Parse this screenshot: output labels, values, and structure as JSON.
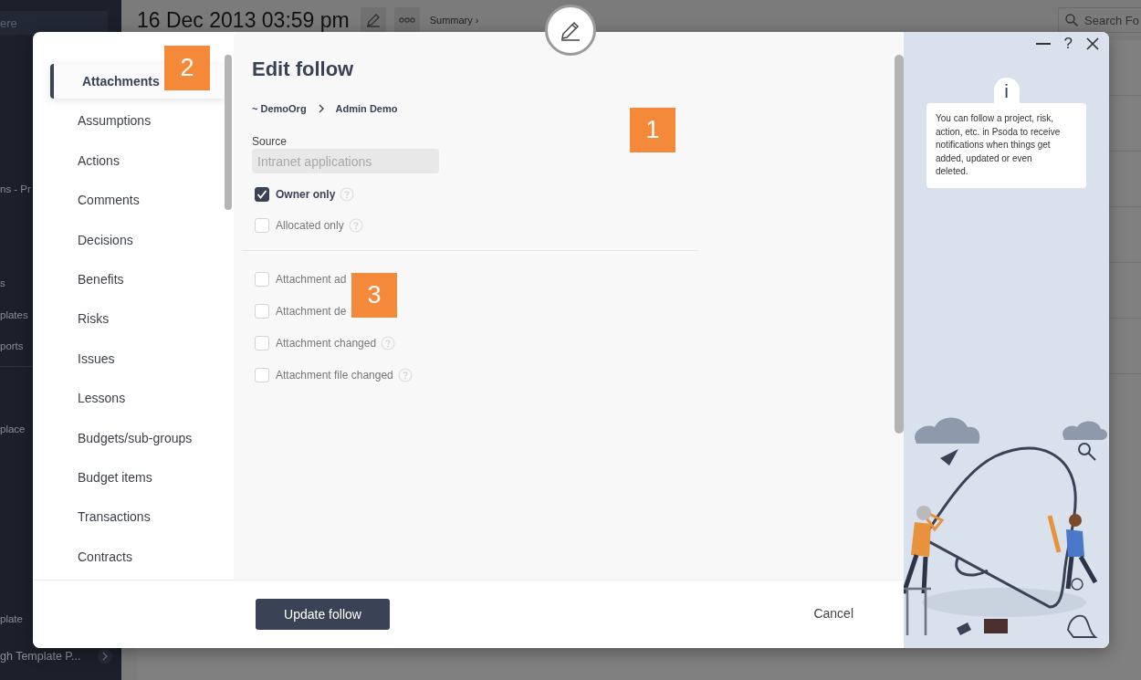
{
  "app_sidebar": {
    "search_placeholder": "ere",
    "items": [
      {
        "label": "ns - Pr"
      },
      {
        "label": "s"
      },
      {
        "label": "plates"
      },
      {
        "label": "ports"
      },
      {
        "label": "place"
      },
      {
        "label": "plate"
      },
      {
        "label": "gh Template P...",
        "has_chevron": true
      }
    ]
  },
  "header": {
    "title": "16 Dec 2013 03:59 pm",
    "summary_link": "Summary ›",
    "search_placeholder": "Search Fo"
  },
  "modal": {
    "nav": [
      {
        "label": "Attachments",
        "selected": true
      },
      {
        "label": "Assumptions",
        "selected": false
      },
      {
        "label": "Actions",
        "selected": false
      },
      {
        "label": "Comments",
        "selected": false
      },
      {
        "label": "Decisions",
        "selected": false
      },
      {
        "label": "Benefits",
        "selected": false
      },
      {
        "label": "Risks",
        "selected": false
      },
      {
        "label": "Issues",
        "selected": false
      },
      {
        "label": "Lessons",
        "selected": false
      },
      {
        "label": "Budgets/sub-groups",
        "selected": false
      },
      {
        "label": "Budget items",
        "selected": false
      },
      {
        "label": "Transactions",
        "selected": false
      },
      {
        "label": "Contracts",
        "selected": false
      }
    ],
    "title": "Edit follow",
    "breadcrumb": [
      "~ DemoOrg",
      "Admin Demo"
    ],
    "source": {
      "label": "Source",
      "value": "Intranet applications",
      "disabled": true
    },
    "filters": [
      {
        "label": "Owner only",
        "checked": true,
        "help": true
      },
      {
        "label": "Allocated only",
        "checked": false,
        "help": true
      }
    ],
    "events": [
      {
        "label": "Attachment ad",
        "checked": false,
        "help": false
      },
      {
        "label": "Attachment de",
        "checked": false,
        "help": false
      },
      {
        "label": "Attachment changed",
        "checked": false,
        "help": true
      },
      {
        "label": "Attachment file changed",
        "checked": false,
        "help": true
      }
    ],
    "help_button": "?",
    "info_tab": "i",
    "info_text": "You can follow a project, risk, action, etc. in Psoda to receive notifications when things get added, updated or even deleted.",
    "primary_button": "Update follow",
    "cancel": "Cancel"
  },
  "callouts": [
    {
      "text": "1"
    },
    {
      "text": "2"
    },
    {
      "text": "3"
    }
  ]
}
